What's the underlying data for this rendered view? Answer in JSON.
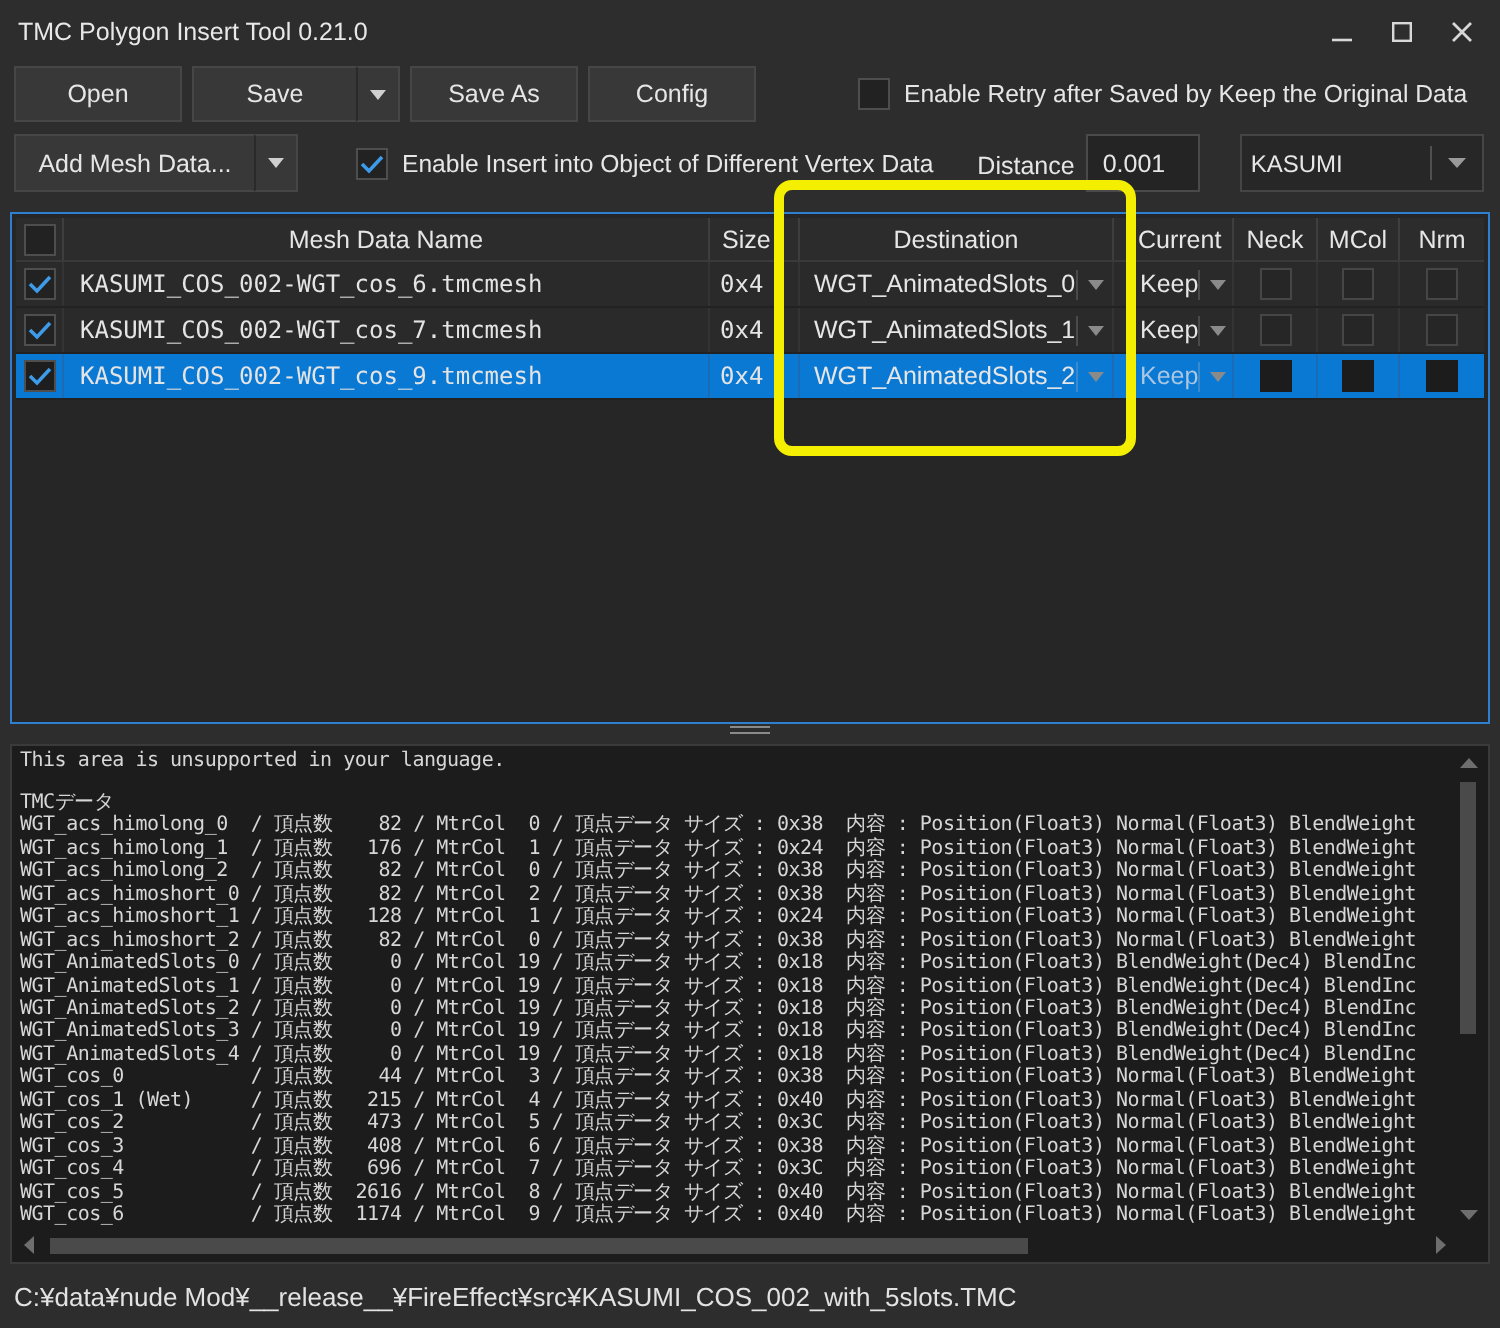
{
  "window": {
    "title": "TMC Polygon Insert Tool 0.21.0"
  },
  "toolbar": {
    "buttons": [
      {
        "label": "Open",
        "kind": "plain"
      },
      {
        "label": "Save",
        "kind": "split"
      },
      {
        "label": "Save As",
        "kind": "plain"
      },
      {
        "label": "Config",
        "kind": "plain"
      }
    ],
    "retry_option": {
      "label": "Enable Retry after Saved by Keep the Original Data",
      "checked": false
    }
  },
  "insert_bar": {
    "add_button": {
      "label": "Add Mesh Data...",
      "kind": "split"
    },
    "different_vertex_option": {
      "label": "Enable Insert into Object of Different Vertex Data",
      "checked": true
    },
    "distance": {
      "label": "Distance",
      "value": "0.001"
    },
    "character": {
      "value": "KASUMI"
    }
  },
  "table": {
    "header_checked": false,
    "columns": [
      "Mesh Data Name",
      "Size",
      "Destination",
      "Current",
      "Neck",
      "MCol",
      "Nrm"
    ],
    "rows": [
      {
        "selected": false,
        "checked": true,
        "name": "KASUMI_COS_002-WGT_cos_6.tmcmesh",
        "size": "0x4",
        "destination": "WGT_AnimatedSlots_0",
        "current": "Keep",
        "flags": [
          false,
          false,
          false
        ]
      },
      {
        "selected": false,
        "checked": true,
        "name": "KASUMI_COS_002-WGT_cos_7.tmcmesh",
        "size": "0x4",
        "destination": "WGT_AnimatedSlots_1",
        "current": "Keep",
        "flags": [
          false,
          false,
          false
        ]
      },
      {
        "selected": true,
        "checked": true,
        "name": "KASUMI_COS_002-WGT_cos_9.tmcmesh",
        "size": "0x4",
        "destination": "WGT_AnimatedSlots_2",
        "current": "Keep",
        "flags": [
          false,
          false,
          false
        ]
      }
    ]
  },
  "log": {
    "notice": "This area is unsupported in your language.",
    "heading": "TMCデータ",
    "lines": [
      "WGT_acs_himolong_0  / 頂点数    82 / MtrCol  0 / 頂点データ サイズ : 0x38  内容 : Position(Float3) Normal(Float3) BlendWeight",
      "WGT_acs_himolong_1  / 頂点数   176 / MtrCol  1 / 頂点データ サイズ : 0x24  内容 : Position(Float3) Normal(Float3) BlendWeight",
      "WGT_acs_himolong_2  / 頂点数    82 / MtrCol  0 / 頂点データ サイズ : 0x38  内容 : Position(Float3) Normal(Float3) BlendWeight",
      "WGT_acs_himoshort_0 / 頂点数    82 / MtrCol  2 / 頂点データ サイズ : 0x38  内容 : Position(Float3) Normal(Float3) BlendWeight",
      "WGT_acs_himoshort_1 / 頂点数   128 / MtrCol  1 / 頂点データ サイズ : 0x24  内容 : Position(Float3) Normal(Float3) BlendWeight",
      "WGT_acs_himoshort_2 / 頂点数    82 / MtrCol  0 / 頂点データ サイズ : 0x38  内容 : Position(Float3) Normal(Float3) BlendWeight",
      "WGT_AnimatedSlots_0 / 頂点数     0 / MtrCol 19 / 頂点データ サイズ : 0x18  内容 : Position(Float3) BlendWeight(Dec4) BlendInc",
      "WGT_AnimatedSlots_1 / 頂点数     0 / MtrCol 19 / 頂点データ サイズ : 0x18  内容 : Position(Float3) BlendWeight(Dec4) BlendInc",
      "WGT_AnimatedSlots_2 / 頂点数     0 / MtrCol 19 / 頂点データ サイズ : 0x18  内容 : Position(Float3) BlendWeight(Dec4) BlendInc",
      "WGT_AnimatedSlots_3 / 頂点数     0 / MtrCol 19 / 頂点データ サイズ : 0x18  内容 : Position(Float3) BlendWeight(Dec4) BlendInc",
      "WGT_AnimatedSlots_4 / 頂点数     0 / MtrCol 19 / 頂点データ サイズ : 0x18  内容 : Position(Float3) BlendWeight(Dec4) BlendInc",
      "WGT_cos_0           / 頂点数    44 / MtrCol  3 / 頂点データ サイズ : 0x38  内容 : Position(Float3) Normal(Float3) BlendWeight",
      "WGT_cos_1 (Wet)     / 頂点数   215 / MtrCol  4 / 頂点データ サイズ : 0x40  内容 : Position(Float3) Normal(Float3) BlendWeight",
      "WGT_cos_2           / 頂点数   473 / MtrCol  5 / 頂点データ サイズ : 0x3C  内容 : Position(Float3) Normal(Float3) BlendWeight",
      "WGT_cos_3           / 頂点数   408 / MtrCol  6 / 頂点データ サイズ : 0x38  内容 : Position(Float3) Normal(Float3) BlendWeight",
      "WGT_cos_4           / 頂点数   696 / MtrCol  7 / 頂点データ サイズ : 0x3C  内容 : Position(Float3) Normal(Float3) BlendWeight",
      "WGT_cos_5           / 頂点数  2616 / MtrCol  8 / 頂点データ サイズ : 0x40  内容 : Position(Float3) Normal(Float3) BlendWeight",
      "WGT_cos_6           / 頂点数  1174 / MtrCol  9 / 頂点データ サイズ : 0x40  内容 : Position(Float3) Normal(Float3) BlendWeight"
    ]
  },
  "status_bar": {
    "path": "C:¥data¥nude Mod¥__release__¥FireEffect¥src¥KASUMI_COS_002_with_5slots.TMC"
  }
}
